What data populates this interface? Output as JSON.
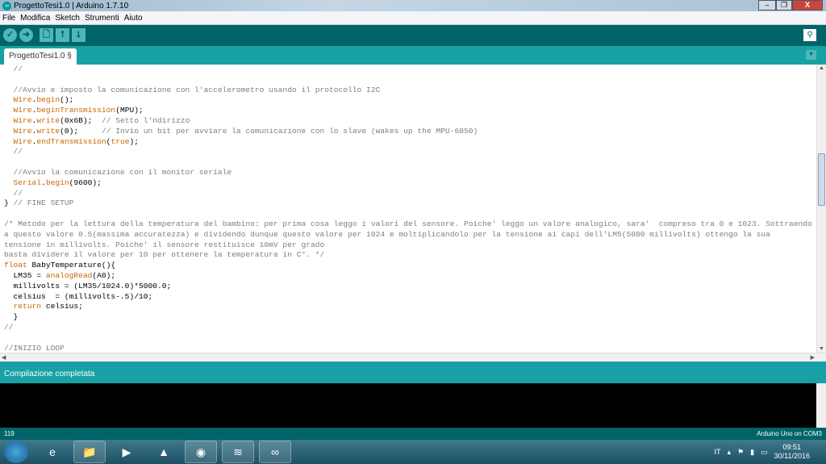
{
  "window": {
    "title": "ProgettoTesi1.0 | Arduino 1.7.10",
    "minimize": "–",
    "restore": "❐",
    "close": "X"
  },
  "menu": [
    "File",
    "Modifica",
    "Sketch",
    "Strumenti",
    "Aiuto"
  ],
  "toolbar": {
    "verify": "✓",
    "upload": "➜",
    "new": "🗋",
    "open": "⭡",
    "save": "⭣",
    "serial_monitor": "⚲"
  },
  "tab": {
    "label": "ProgettoTesi1.0 §",
    "menu": "▼"
  },
  "code": [
    [
      [
        "  //",
        "cm"
      ]
    ],
    [],
    [
      [
        "  //Avvio e imposto la comunicazione con l'accelerometro usando il protocollo I2C",
        "cm"
      ]
    ],
    [
      [
        "  ",
        ""
      ],
      [
        "Wire",
        "kw"
      ],
      [
        ".",
        ""
      ],
      [
        "begin",
        "fn"
      ],
      [
        "();",
        ""
      ]
    ],
    [
      [
        "  ",
        ""
      ],
      [
        "Wire",
        "kw"
      ],
      [
        ".",
        ""
      ],
      [
        "beginTransmission",
        "fn"
      ],
      [
        "(MPU);",
        ""
      ]
    ],
    [
      [
        "  ",
        ""
      ],
      [
        "Wire",
        "kw"
      ],
      [
        ".",
        ""
      ],
      [
        "write",
        "fn"
      ],
      [
        "(0x6B);  ",
        ""
      ],
      [
        "// Setto l'ndirizzo",
        "cm"
      ]
    ],
    [
      [
        "  ",
        ""
      ],
      [
        "Wire",
        "kw"
      ],
      [
        ".",
        ""
      ],
      [
        "write",
        "fn"
      ],
      [
        "(0);     ",
        ""
      ],
      [
        "// Invio un bit per avviare la comunicazione con lo slave (wakes up the MPU-6050)",
        "cm"
      ]
    ],
    [
      [
        "  ",
        ""
      ],
      [
        "Wire",
        "kw"
      ],
      [
        ".",
        ""
      ],
      [
        "endTransmission",
        "fn"
      ],
      [
        "(",
        ""
      ],
      [
        "true",
        "kw"
      ],
      [
        ");",
        ""
      ]
    ],
    [
      [
        "  //",
        "cm"
      ]
    ],
    [],
    [
      [
        "  //Avvio la comunicazione con il monitor seriale",
        "cm"
      ]
    ],
    [
      [
        "  ",
        ""
      ],
      [
        "Serial",
        "kw"
      ],
      [
        ".",
        ""
      ],
      [
        "begin",
        "fn"
      ],
      [
        "(9600);",
        ""
      ]
    ],
    [
      [
        "  //",
        "cm"
      ]
    ],
    [
      [
        "} ",
        ""
      ],
      [
        "// FINE SETUP",
        "cm"
      ]
    ],
    [],
    [
      [
        "/* Metodo per la lettura della temperatura del bambino: per prima cosa leggo i valori del sensore. Poiche' leggo un valore analogico, sara'  compreso tra 0 e 1023. Sottraendo",
        "cm"
      ]
    ],
    [
      [
        "a questo valore 0.5(massima accuratezza) e dividendo dunque questo valore per 1024 e moltiplicandolo per la tensione ai capi dell'LM5(5000 millivolts) ottengo la sua",
        "cm"
      ]
    ],
    [
      [
        "tensione in millivolts. Poiche' il sensore restituisce 10mV per grado",
        "cm"
      ]
    ],
    [
      [
        "basta dividere il valore per 10 per ottenere la temperatura in C°. */",
        "cm"
      ]
    ],
    [
      [
        "float",
        "kw"
      ],
      [
        " BabyTemperature(){",
        ""
      ]
    ],
    [
      [
        "  LM35 = ",
        ""
      ],
      [
        "analogRead",
        "fn"
      ],
      [
        "(A0);",
        ""
      ]
    ],
    [
      [
        "  millivolts = (LM35/1024.0)*5000.0;",
        ""
      ]
    ],
    [
      [
        "  celsius  = (millivolts-.5)/10;",
        ""
      ]
    ],
    [
      [
        "  ",
        ""
      ],
      [
        "return",
        "kw"
      ],
      [
        " celsius;",
        ""
      ]
    ],
    [
      [
        "  }",
        ""
      ]
    ],
    [
      [
        "//",
        "cm"
      ]
    ],
    [],
    [
      [
        "//INIZIO LOOP",
        "cm"
      ]
    ]
  ],
  "status": {
    "message": "Compilazione completata"
  },
  "bottom": {
    "line": "119",
    "board": "Arduino Uno on COM3"
  },
  "taskbar": {
    "apps": [
      "e",
      "📁",
      "▶",
      "▲",
      "◉",
      "≋",
      "∞"
    ],
    "lang": "IT",
    "time": "09:51",
    "date": "30/11/2016"
  }
}
